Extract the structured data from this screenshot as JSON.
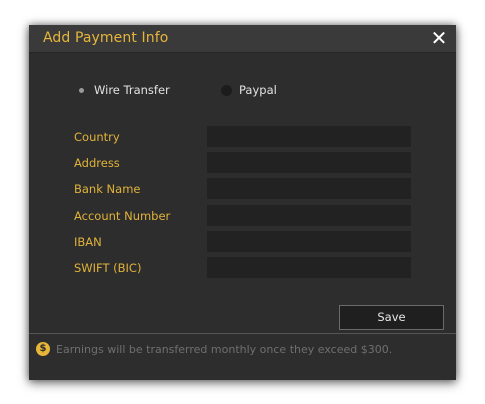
{
  "dialog": {
    "title": "Add Payment Info",
    "close_label": "✕"
  },
  "payment_method": {
    "options": [
      {
        "label": "Wire Transfer",
        "selected": true
      },
      {
        "label": "Paypal",
        "selected": false
      }
    ]
  },
  "fields": [
    {
      "label": "Country",
      "value": ""
    },
    {
      "label": "Address",
      "value": ""
    },
    {
      "label": "Bank Name",
      "value": ""
    },
    {
      "label": "Account Number",
      "value": ""
    },
    {
      "label": "IBAN",
      "value": ""
    },
    {
      "label": "SWIFT (BIC)",
      "value": ""
    }
  ],
  "actions": {
    "save_label": "Save"
  },
  "footer": {
    "icon": "dollar-coin-icon",
    "icon_glyph": "$",
    "note": "Earnings will be transferred monthly once they exceed $300."
  },
  "colors": {
    "accent": "#e7b53a",
    "background": "#2d2d2d",
    "input_background": "#222222"
  }
}
